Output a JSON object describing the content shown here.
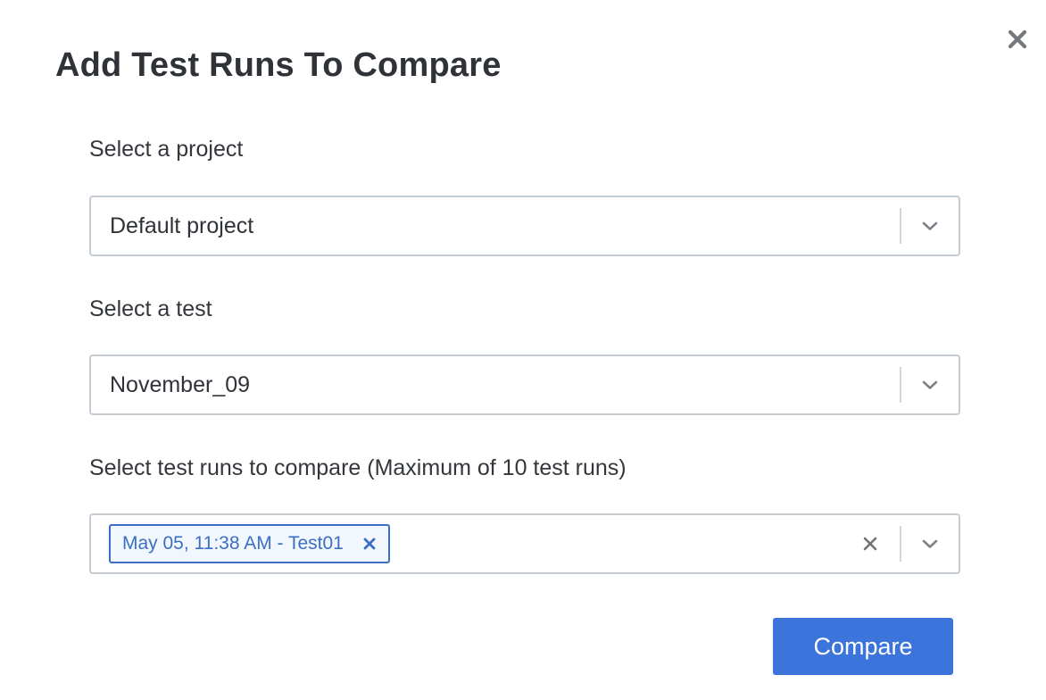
{
  "dialog": {
    "title": "Add Test Runs To Compare",
    "close_icon": "close-icon"
  },
  "project": {
    "label": "Select a project",
    "value": "Default project"
  },
  "test": {
    "label": "Select a test",
    "value": "November_09"
  },
  "test_runs": {
    "label": "Select test runs to compare (Maximum of 10 test runs)",
    "selected": [
      {
        "label": "May 05, 11:38 AM - Test01"
      }
    ]
  },
  "actions": {
    "compare_label": "Compare"
  },
  "colors": {
    "accent": "#3b74db",
    "chip_border": "#3b6fc4",
    "text": "#2f3338",
    "border": "#c6ccd4"
  }
}
